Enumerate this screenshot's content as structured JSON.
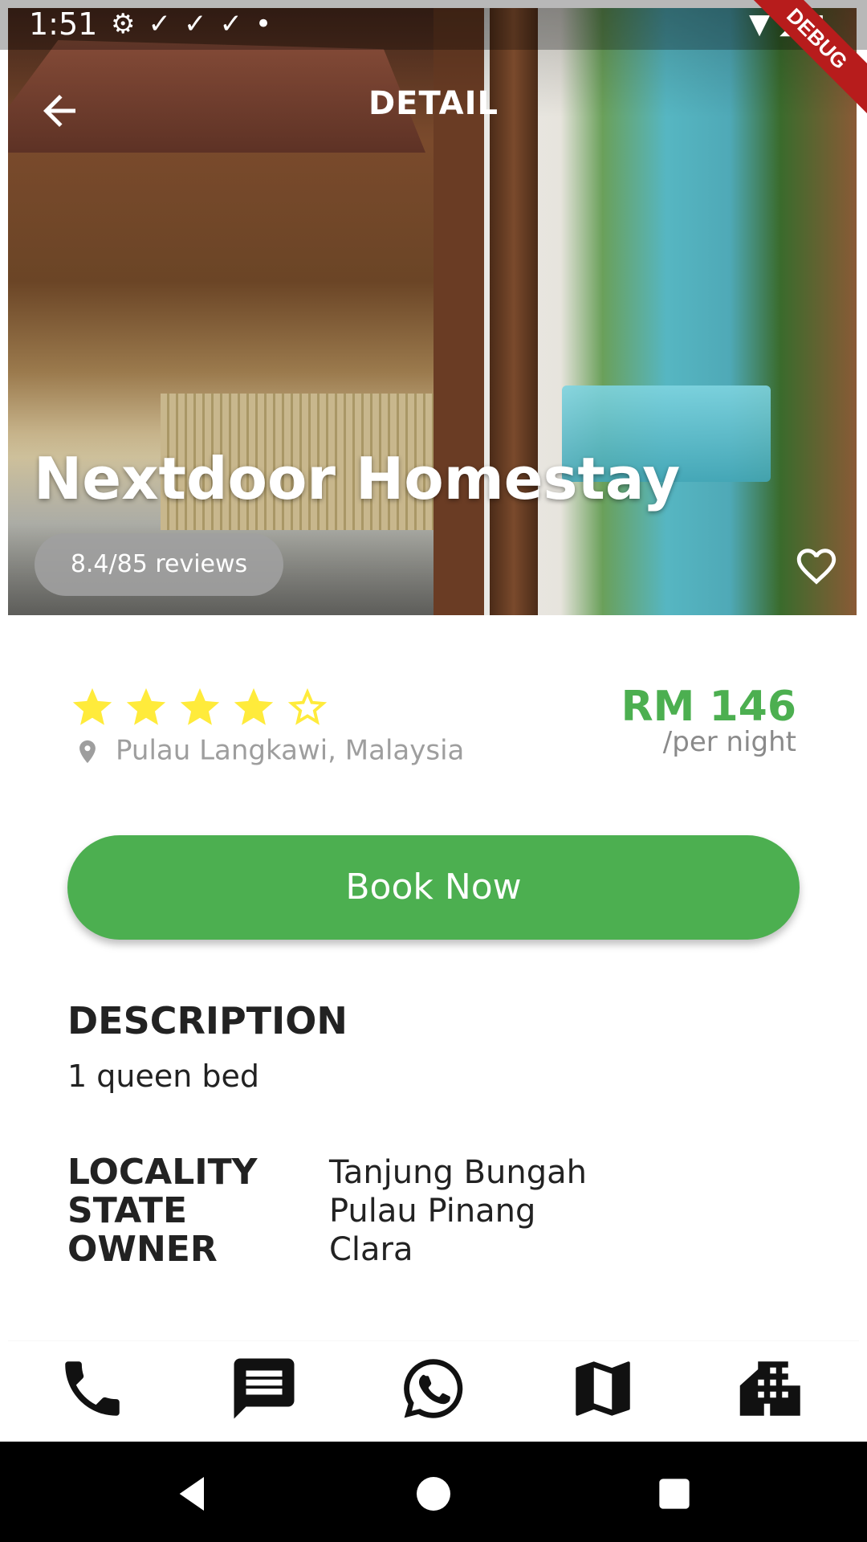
{
  "status_bar": {
    "time": "1:51",
    "icons_left": [
      "gear-icon",
      "check-icon",
      "check-icon",
      "check-icon",
      "dot-icon"
    ],
    "icons_right": [
      "wifi-icon",
      "signal-icon",
      "battery-icon"
    ],
    "debug_label": "DEBUG"
  },
  "header": {
    "title": "DETAIL",
    "back_icon": "arrow-back-icon",
    "favorite_icon": "heart-outline-icon"
  },
  "hero": {
    "place_name": "Nextdoor Homestay",
    "reviews": "8.4/85 reviews"
  },
  "summary": {
    "rating_stars": 4,
    "rating_max": 5,
    "location": "Pulau Langkawi, Malaysia",
    "price": "RM 146",
    "price_unit": "/per night"
  },
  "actions": {
    "book_label": "Book Now"
  },
  "description": {
    "title": "DESCRIPTION",
    "text": "1 queen bed"
  },
  "details": [
    {
      "key": "LOCALITY",
      "value": "Tanjung Bungah"
    },
    {
      "key": "STATE",
      "value": "Pulau Pinang"
    },
    {
      "key": "OWNER",
      "value": "Clara"
    }
  ],
  "bottom_nav": [
    "phone-icon",
    "message-icon",
    "whatsapp-icon",
    "map-icon",
    "homes-icon"
  ],
  "system_nav": [
    "back-triangle-icon",
    "home-circle-icon",
    "recents-square-icon"
  ],
  "colors": {
    "accent_green": "#4caf50",
    "star_yellow": "#ffeb3b",
    "debug_red": "#b71c1c"
  }
}
